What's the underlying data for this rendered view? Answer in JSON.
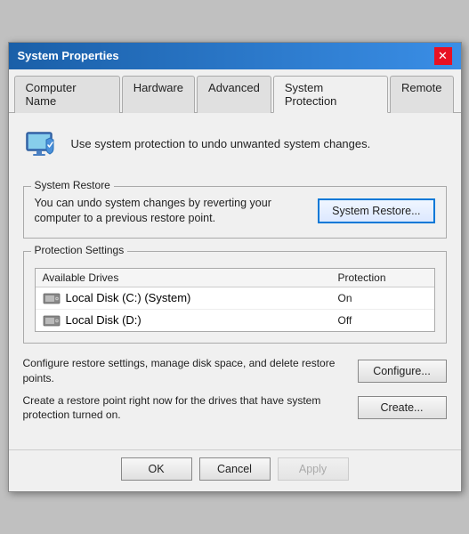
{
  "window": {
    "title": "System Properties",
    "close_label": "✕"
  },
  "tabs": [
    {
      "label": "Computer Name",
      "active": false
    },
    {
      "label": "Hardware",
      "active": false
    },
    {
      "label": "Advanced",
      "active": false
    },
    {
      "label": "System Protection",
      "active": true
    },
    {
      "label": "Remote",
      "active": false
    }
  ],
  "header": {
    "description": "Use system protection to undo unwanted system changes."
  },
  "system_restore": {
    "group_label": "System Restore",
    "description": "You can undo system changes by reverting your computer to a previous restore point.",
    "button_label": "System Restore..."
  },
  "protection_settings": {
    "group_label": "Protection Settings",
    "table": {
      "headers": [
        "Available Drives",
        "Protection"
      ],
      "rows": [
        {
          "drive": "Local Disk (C:) (System)",
          "protection": "On"
        },
        {
          "drive": "Local Disk (D:)",
          "protection": "Off"
        }
      ]
    }
  },
  "configure_section": {
    "description": "Configure restore settings, manage disk space, and delete restore points.",
    "button_label": "Configure..."
  },
  "create_section": {
    "description": "Create a restore point right now for the drives that have system protection turned on.",
    "button_label": "Create..."
  },
  "dialog_buttons": {
    "ok": "OK",
    "cancel": "Cancel",
    "apply": "Apply"
  }
}
